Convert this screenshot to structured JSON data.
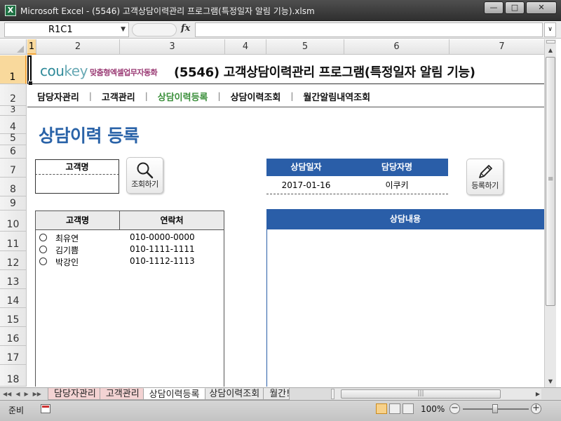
{
  "window": {
    "title": "Microsoft Excel - (5546) 고객상담이력관리 프로그램(특정일자 알림 기능).xlsm",
    "app_icon": "excel-icon",
    "buttons": [
      "minimize-icon",
      "maximize-icon",
      "close-icon"
    ]
  },
  "formula_bar": {
    "name_box": "R1C1",
    "fx": "fx",
    "value": ""
  },
  "columns": [
    "1",
    "2",
    "3",
    "4",
    "5",
    "6",
    "7"
  ],
  "rows": [
    "1",
    "2",
    "3",
    "4",
    "5",
    "6",
    "7",
    "8",
    "9",
    "10",
    "11",
    "12",
    "13",
    "14",
    "15",
    "16",
    "17",
    "18"
  ],
  "header": {
    "brand_main": "cou",
    "brand_key": "key",
    "brand_tag": "맞춤형엑셀업무자동화",
    "title": "(5546) 고객상담이력관리 프로그램(특정일자 알림 기능)"
  },
  "nav": {
    "items": [
      {
        "label": "담당자관리",
        "active": false
      },
      {
        "label": "고객관리",
        "active": false
      },
      {
        "label": "상담이력등록",
        "active": true
      },
      {
        "label": "상담이력조회",
        "active": false
      },
      {
        "label": "월간알림내역조회",
        "active": false
      }
    ],
    "separator": "|"
  },
  "page_title": "상담이력 등록",
  "search": {
    "label": "고객명",
    "value": "",
    "button_label": "조회하기",
    "button_icon": "magnifier-icon"
  },
  "customer_list": {
    "headers": [
      "고객명",
      "연락처"
    ],
    "rows": [
      {
        "name": "최유연",
        "phone": "010-0000-0000"
      },
      {
        "name": "김기쁨",
        "phone": "010-1111-1111"
      },
      {
        "name": "박강인",
        "phone": "010-1112-1113"
      }
    ]
  },
  "consultation": {
    "date_label": "상담일자",
    "manager_label": "담당자명",
    "date_value": "2017-01-16",
    "manager_value": "이쿠키",
    "register_label": "등록하기",
    "register_icon": "pencil-icon",
    "content_label": "상담내용",
    "content_value": ""
  },
  "sheet_tabs": [
    {
      "label": "담당자관리",
      "style": "pink"
    },
    {
      "label": "고객관리",
      "style": "pink"
    },
    {
      "label": "상담이력등록",
      "style": "active"
    },
    {
      "label": "상담이력조회",
      "style": "normal"
    },
    {
      "label": "월간!",
      "style": "cut"
    }
  ],
  "status_bar": {
    "ready": "준비",
    "zoom": "100%"
  },
  "colors": {
    "accent_blue": "#2a5ea8",
    "nav_active": "#3a8f3a",
    "brand": "#2f8a99",
    "brand_tag": "#9a3a74"
  }
}
